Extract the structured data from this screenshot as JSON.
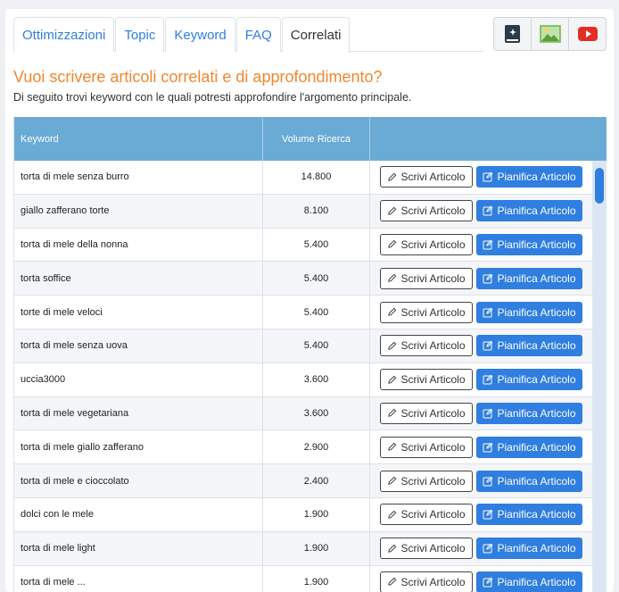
{
  "tabs": [
    {
      "label": "Ottimizzazioni"
    },
    {
      "label": "Topic"
    },
    {
      "label": "Keyword"
    },
    {
      "label": "FAQ"
    },
    {
      "label": "Correlati"
    }
  ],
  "active_tab": "Correlati",
  "icon_buttons": [
    {
      "icon": "ai-sparkle-book-icon"
    },
    {
      "icon": "image-icon"
    },
    {
      "icon": "youtube-icon"
    }
  ],
  "heading": "Vuoi scrivere articoli correlati e di approfondimento?",
  "subtext": "Di seguito trovi keyword con le quali potresti approfondire l'argomento principale.",
  "table": {
    "headers": {
      "keyword": "Keyword",
      "volume": "Volume Ricerca"
    },
    "write_label": "Scrivi Articolo",
    "plan_label": "Pianifica Articolo",
    "rows": [
      {
        "keyword": "torta di mele senza burro",
        "volume": "14.800"
      },
      {
        "keyword": "giallo zafferano torte",
        "volume": "8.100"
      },
      {
        "keyword": "torta di mele della nonna",
        "volume": "5.400"
      },
      {
        "keyword": "torta soffice",
        "volume": "5.400"
      },
      {
        "keyword": "torte di mele veloci",
        "volume": "5.400"
      },
      {
        "keyword": "torta di mele senza uova",
        "volume": "5.400"
      },
      {
        "keyword": "uccia3000",
        "volume": "3.600"
      },
      {
        "keyword": "torta di mele vegetariana",
        "volume": "3.600"
      },
      {
        "keyword": "torta di mele giallo zafferano",
        "volume": "2.900"
      },
      {
        "keyword": "torta di mele e cioccolato",
        "volume": "2.400"
      },
      {
        "keyword": "dolci con le mele",
        "volume": "1.900"
      },
      {
        "keyword": "torta di mele light",
        "volume": "1.900"
      },
      {
        "keyword": "torta di mele ...",
        "volume": "1.900"
      }
    ]
  },
  "colors": {
    "accent": "#2f7ee0",
    "heading": "#f2862f",
    "table_header": "#6aabd6"
  }
}
